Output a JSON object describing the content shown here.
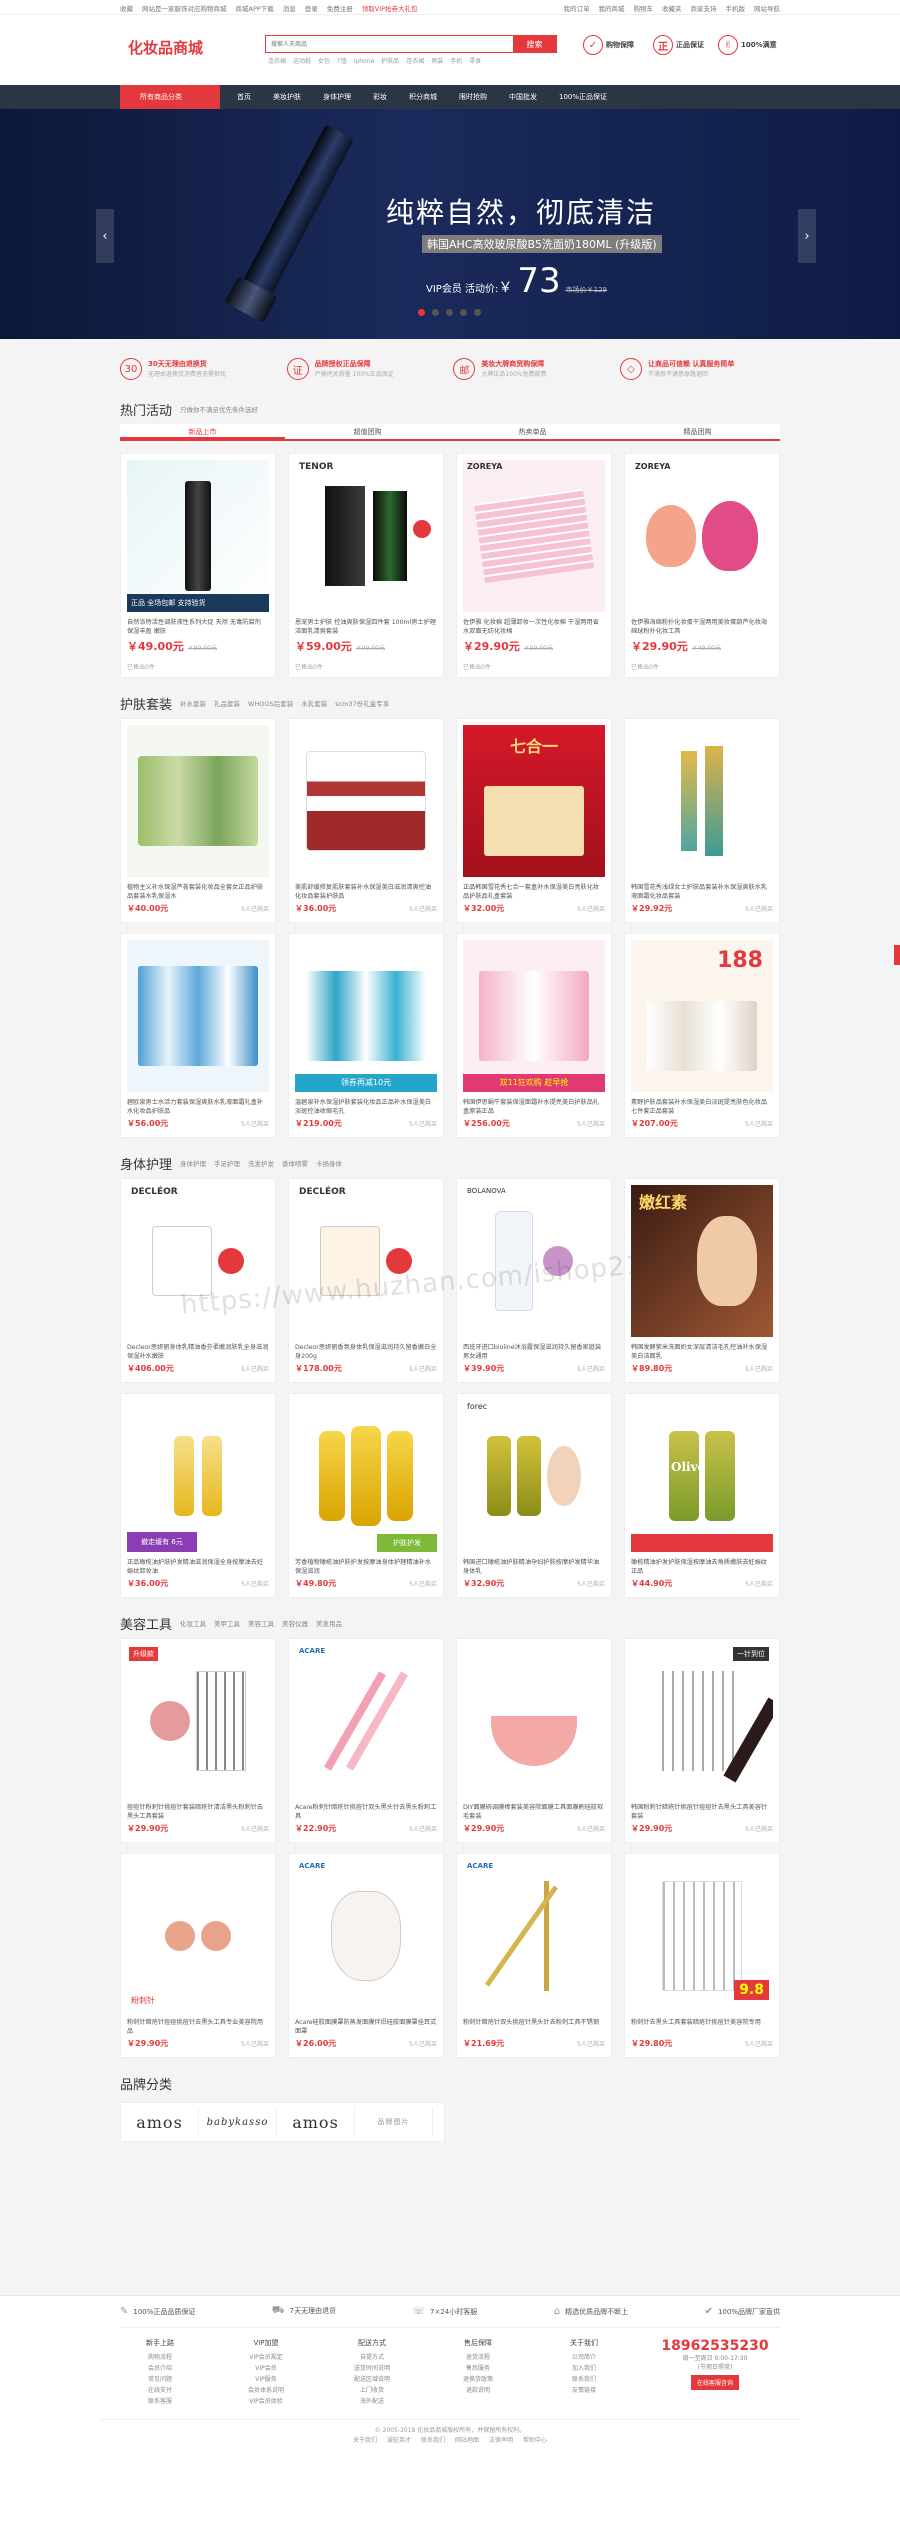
{
  "topbar": {
    "left": [
      "收藏",
      "网站是一家服饰对应购物商城",
      "商城APP下载",
      "消息",
      "登录",
      "免费注册"
    ],
    "highlight": "领取VIP抢券大礼包",
    "right": [
      "我的订单",
      "我的商城",
      "购物车",
      "收藏夹",
      "商家支持",
      "手机版",
      "网站导航"
    ]
  },
  "header": {
    "logo": "化妆品商城",
    "search_placeholder": "搜索人天商品",
    "search_button": "搜索",
    "hotwords": [
      "连衣裙",
      "运动鞋",
      "女包",
      "T恤",
      "iphone",
      "护肤品",
      "连衣裙",
      "男装",
      "手机",
      "零食"
    ],
    "guarantees": [
      {
        "icon": "✓",
        "label": "购物保障"
      },
      {
        "icon": "正",
        "label": "正品保证"
      },
      {
        "icon": "✌",
        "label": "100%满意"
      }
    ]
  },
  "nav": {
    "all": "所有商品分类",
    "items": [
      "首页",
      "美妆护肤",
      "身体护理",
      "彩妆",
      "积分商城",
      "限时抢购",
      "中国批发",
      "100%正品保证"
    ]
  },
  "banner": {
    "title": "纯粹自然，彻底清洁",
    "subtitle": "韩国AHC高效玻尿酸B5洗面奶180ML (升级版)",
    "price_label": "VIP会员 活动价:",
    "currency": "￥",
    "price": "73",
    "old_price": "市场价￥129",
    "prev": "‹",
    "next": "›"
  },
  "services": [
    {
      "icon": "30",
      "title": "30天无理由退换货",
      "desc": "无理由退换货消费者无需担忧"
    },
    {
      "icon": "证",
      "title": "品牌授权正品保障",
      "desc": "严格把关质量 100%正品保证"
    },
    {
      "icon": "邮",
      "title": "美妆大牌商贸购保障",
      "desc": "大牌正品100%免费邮费"
    },
    {
      "icon": "◇",
      "title": "让商品可信赖 认真服务简单",
      "desc": "不满意不满意原路退回"
    }
  ],
  "hot": {
    "title": "热门活动",
    "subtitle": "只做你不满足优先条件选好",
    "tabs": [
      "新品上市",
      "超值团购",
      "热卖单品",
      "精品团购"
    ],
    "products": [
      {
        "name": "自然派特活性调肤液性系列大促 天然 无毒防腐剂 保湿丰盈 嫩肤",
        "price": "￥49.00元",
        "old": "￥89.00元",
        "sold": "已售出0件",
        "tag": "正品 全场包邮 支持验货"
      },
      {
        "name": "恩宠男士护肤 控油爽肤保湿四件套 100ml男士护理洁面乳清爽套装",
        "price": "￥59.00元",
        "old": "￥99.00元",
        "sold": "已售出0件",
        "tag": "TENOR"
      },
      {
        "name": "佐伊雅 化妆棉 超薄卸妆一次性化妆棉 干湿两用省水双面无纺化妆棉",
        "price": "￥29.90元",
        "old": "￥59.00元",
        "sold": "已售出0件",
        "tag": "ZOREYA"
      },
      {
        "name": "佐伊雅海绵粉扑化妆蛋干湿两用美妆蛋葫芦化妆海绵球粉扑化妆工具",
        "price": "￥29.90元",
        "old": "￥49.00元",
        "sold": "已售出0件",
        "tag": "ZOREYA"
      }
    ]
  },
  "skincare": {
    "title": "护肤套装",
    "subs": [
      "补水套装",
      "礼品套装",
      "WHOOS后套装",
      "水乳套装",
      "scm37份礼盒专享"
    ],
    "products": [
      {
        "name": "植物主义补水保湿芦荟套装化妆品全套女正品护肤品套装水乳保湿水",
        "price": "￥40.00元",
        "sold": "5人已购买",
        "tag": ""
      },
      {
        "name": "美肌舒缓修复肌肤套装补水保湿美白滋润清爽控油化妆品套装护肤品",
        "price": "￥36.00元",
        "sold": "5人已购买",
        "tag": ""
      },
      {
        "name": "正品韩国雪花秀七合一套盒补水保湿美白亮肤化妆品护肤品礼盒套装",
        "price": "￥32.00元",
        "sold": "5人已购买",
        "tag": "七合一"
      },
      {
        "name": "韩国雪花秀浅绿女士护肤品套装补水保湿爽肤水乳液面霜化妆品套装",
        "price": "￥29.92元",
        "sold": "5人已购买",
        "tag": ""
      },
      {
        "name": "碧欧泉男士水活力套装保湿爽肤水乳液面霜礼盒补水化妆品护肤品",
        "price": "￥56.00元",
        "sold": "5人已购买",
        "tag": ""
      },
      {
        "name": "温碧泉补水保湿护肤套装化妆品正品补水保湿美白淡斑控油收缩毛孔",
        "price": "￥219.00元",
        "sold": "5人已购买",
        "tag": "领券再减10元"
      },
      {
        "name": "韩国伊思蜗牛套装保湿面霜补水提亮美白护肤品礼盒原装正品",
        "price": "￥256.00元",
        "sold": "5人已购买",
        "tag": "双11狂欢购 趁早抢"
      },
      {
        "name": "素野护肤品套装补水保湿美白淡斑提亮肤色化妆品七件套正品套装",
        "price": "￥207.00元",
        "sold": "5人已购买",
        "tag": "188"
      }
    ]
  },
  "body": {
    "title": "身体护理",
    "subs": [
      "身体护理",
      "手足护理",
      "洗发护发",
      "香体喷雾",
      "卡扬身体"
    ],
    "products": [
      {
        "name": "Decleor思妍丽身体乳精油香芬柔嫩润肤乳全身滋润保湿补水嫩肤",
        "price": "￥406.00元",
        "sold": "5人已购买",
        "tag": "DECLÉOR"
      },
      {
        "name": "Decleor思妍丽香氛身体乳保湿滋润持久留香嫩白全身200g",
        "price": "￥178.00元",
        "sold": "5人已购买",
        "tag": "DECLÉOR"
      },
      {
        "name": "西班牙进口bioline沐浴露保湿滋润持久留香家庭装男女通用",
        "price": "￥39.90元",
        "sold": "5人已购买",
        "tag": "BOLANOVA"
      },
      {
        "name": "韩国发酵紫米洗面奶女深层清洁毛孔控油补水保湿美白洁面乳",
        "price": "￥89.80元",
        "sold": "5人已购买",
        "tag": "嫩红素"
      },
      {
        "name": "正品橄榄油护肤护发精油滋润保湿全身按摩油去妊娠纹卸妆油",
        "price": "￥36.00元",
        "sold": "5人已购买",
        "tag": "撤走缓有 6元"
      },
      {
        "name": "芳香植物橄榄油护肤护发按摩油身体护理精油补水保湿滋润",
        "price": "￥49.80元",
        "sold": "5人已购买",
        "tag": "护肤护发"
      },
      {
        "name": "韩国进口橄榄油护肤精油孕妇护肤按摩护发精华油身体乳",
        "price": "￥32.90元",
        "sold": "5人已购买",
        "tag": "forec"
      },
      {
        "name": "橄榄精油护发护肤保湿按摩油去角质嫩肤去妊娠纹正品",
        "price": "￥44.90元",
        "sold": "5人已购买",
        "tag": "Olive"
      }
    ]
  },
  "tools": {
    "title": "美容工具",
    "subs": [
      "化妆工具",
      "美甲工具",
      "美容工具",
      "美容仪器",
      "美发用品"
    ],
    "products": [
      {
        "name": "痘痘针粉刺针挑痘针套装暗疮针清洁黑头粉刺针去黑头工具套装",
        "price": "￥29.90元",
        "sold": "5人已购买",
        "tag": "升级款"
      },
      {
        "name": "Acare粉刺针暗疮针挑痘针双头黑头针去黑头粉刺工具",
        "price": "￥22.90元",
        "sold": "5人已购买",
        "tag": "ACARE"
      },
      {
        "name": "DIY面膜碗调膜棒套装美容院面膜工具面膜刷硅胶软毛套装",
        "price": "￥29.90元",
        "sold": "5人已购买",
        "tag": ""
      },
      {
        "name": "韩国粉刺针暗疮针挑痘针痘痘针去黑头工具美容针套装",
        "price": "￥29.90元",
        "sold": "5人已购买",
        "tag": "一针到位"
      },
      {
        "name": "粉刺针暗疮针痘痘挑痘针去黑头工具专业美容院用品",
        "price": "￥29.90元",
        "sold": "5人已购买",
        "tag": "粉刺针"
      },
      {
        "name": "Acare硅胶面膜罩防蒸发面膜伴侣硅胶面膜罩挂耳式面罩",
        "price": "￥26.00元",
        "sold": "5人已购买",
        "tag": "ACARE"
      },
      {
        "name": "粉刺针暗疮针双头挑痘针黑头针去粉刺工具不锈钢",
        "price": "￥21.69元",
        "sold": "5人已购买",
        "tag": "ACARE"
      },
      {
        "name": "粉刺针去黑头工具套装暗疮针挑痘针美容院专用",
        "price": "￥29.80元",
        "sold": "5人已购买",
        "tag": "9.8"
      }
    ]
  },
  "brands": {
    "title": "品牌分类",
    "items": [
      "amos",
      "babykasso",
      "amos",
      "品牌图片"
    ]
  },
  "footer": {
    "services": [
      "100%正品品质保证",
      "7天无理由退货",
      "7×24小时客服",
      "精选优质品牌不断上",
      "100%品牌厂家直供"
    ],
    "cols": [
      {
        "title": "新手上路",
        "links": [
          "购物流程",
          "会员介绍",
          "常见问题",
          "在线支付",
          "联系客服"
        ]
      },
      {
        "title": "VIP加盟",
        "links": [
          "VIP会员规定",
          "VIP会员",
          "VIP服务",
          "会员体系说明",
          "VIP会员体验"
        ]
      },
      {
        "title": "配送方式",
        "links": [
          "自提方式",
          "送货时间说明",
          "配送区域说明",
          "上门收货",
          "海外配送"
        ]
      },
      {
        "title": "售后保障",
        "links": [
          "退货流程",
          "售后服务",
          "退换货政策",
          "退款说明"
        ]
      },
      {
        "title": "关于我们",
        "links": [
          "公司简介",
          "加入我们",
          "联系我们",
          "友情链接"
        ]
      }
    ],
    "contact": {
      "tel": "18962535230",
      "hours": "周一至周日 9:00-17:30",
      "note": "(节假日照常)",
      "btn": "在线客服咨询"
    },
    "copyright": "© 2005-2018 化妆品商城版权所有，并保留所有权利。",
    "links": [
      "关于我们",
      "诚征英才",
      "联系我们",
      "网站地图",
      "法律声明",
      "帮助中心"
    ]
  },
  "watermark": "https://www.huzhan.com/ishop21106"
}
